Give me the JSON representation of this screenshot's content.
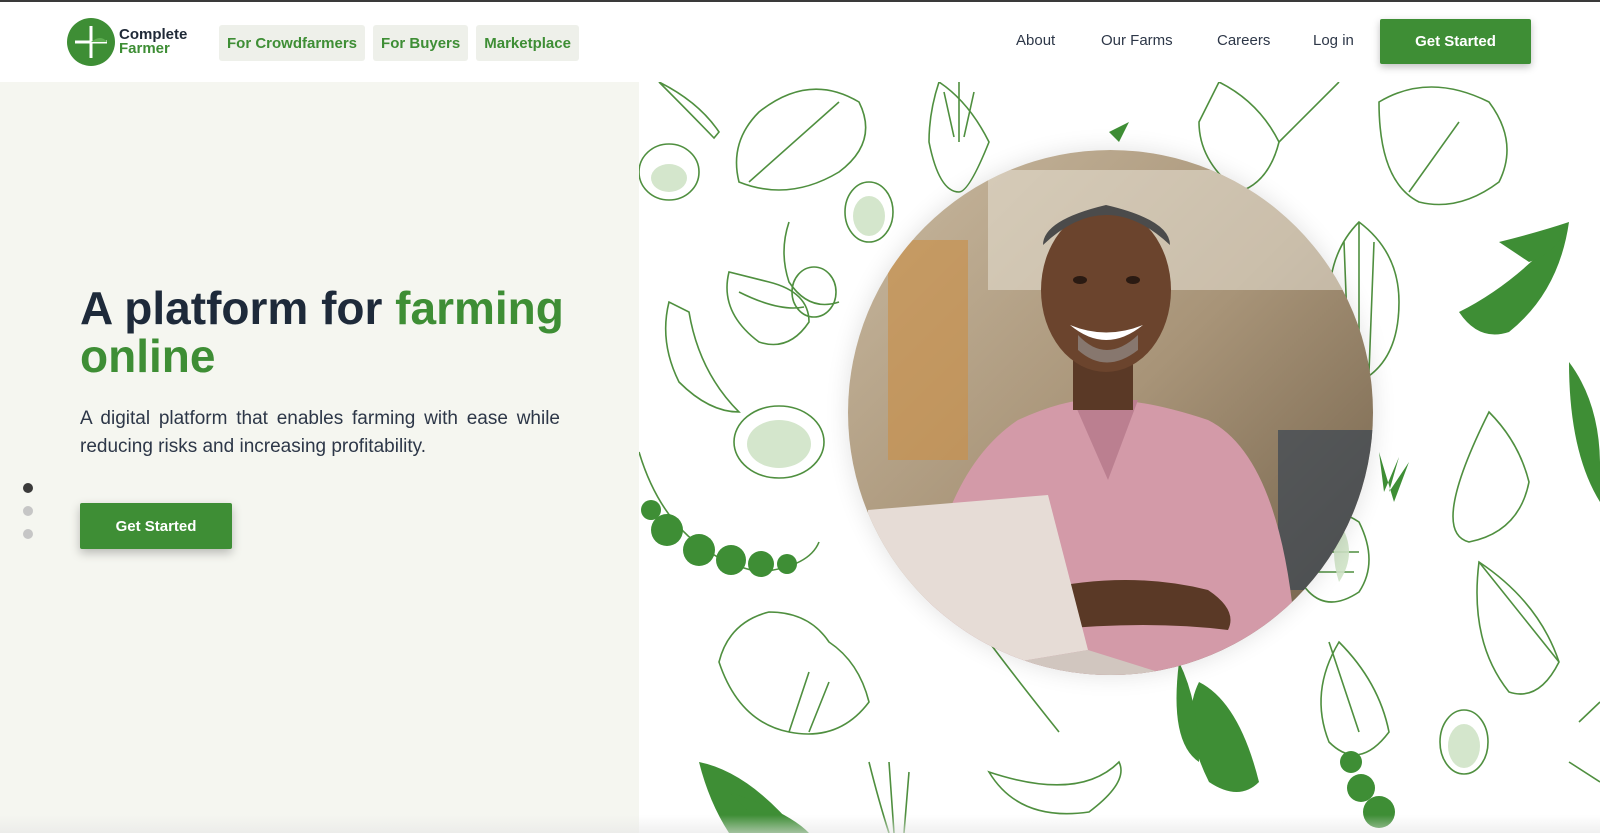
{
  "brand": {
    "name_top": "Complete",
    "name_bottom": "Farmer"
  },
  "nav": {
    "pills": [
      "For Crowdfarmers",
      "For Buyers",
      "Marketplace"
    ],
    "links": [
      "About",
      "Our Farms",
      "Careers",
      "Log in"
    ],
    "cta": "Get Started"
  },
  "hero": {
    "title_part1": "A platform for ",
    "title_accent1": "farming",
    "title_accent2": "online",
    "subtitle": "A digital platform that enables farming with ease while reducing risks and increasing profitability.",
    "cta": "Get Started",
    "slides": {
      "count": 3,
      "active": 1
    }
  },
  "colors": {
    "brand_green": "#3e8e35",
    "hero_bg": "#f5f6f0",
    "pill_bg": "#eef0ea",
    "heading": "#1e2a3a"
  },
  "icons": [
    "complete-farmer-logo-icon"
  ]
}
